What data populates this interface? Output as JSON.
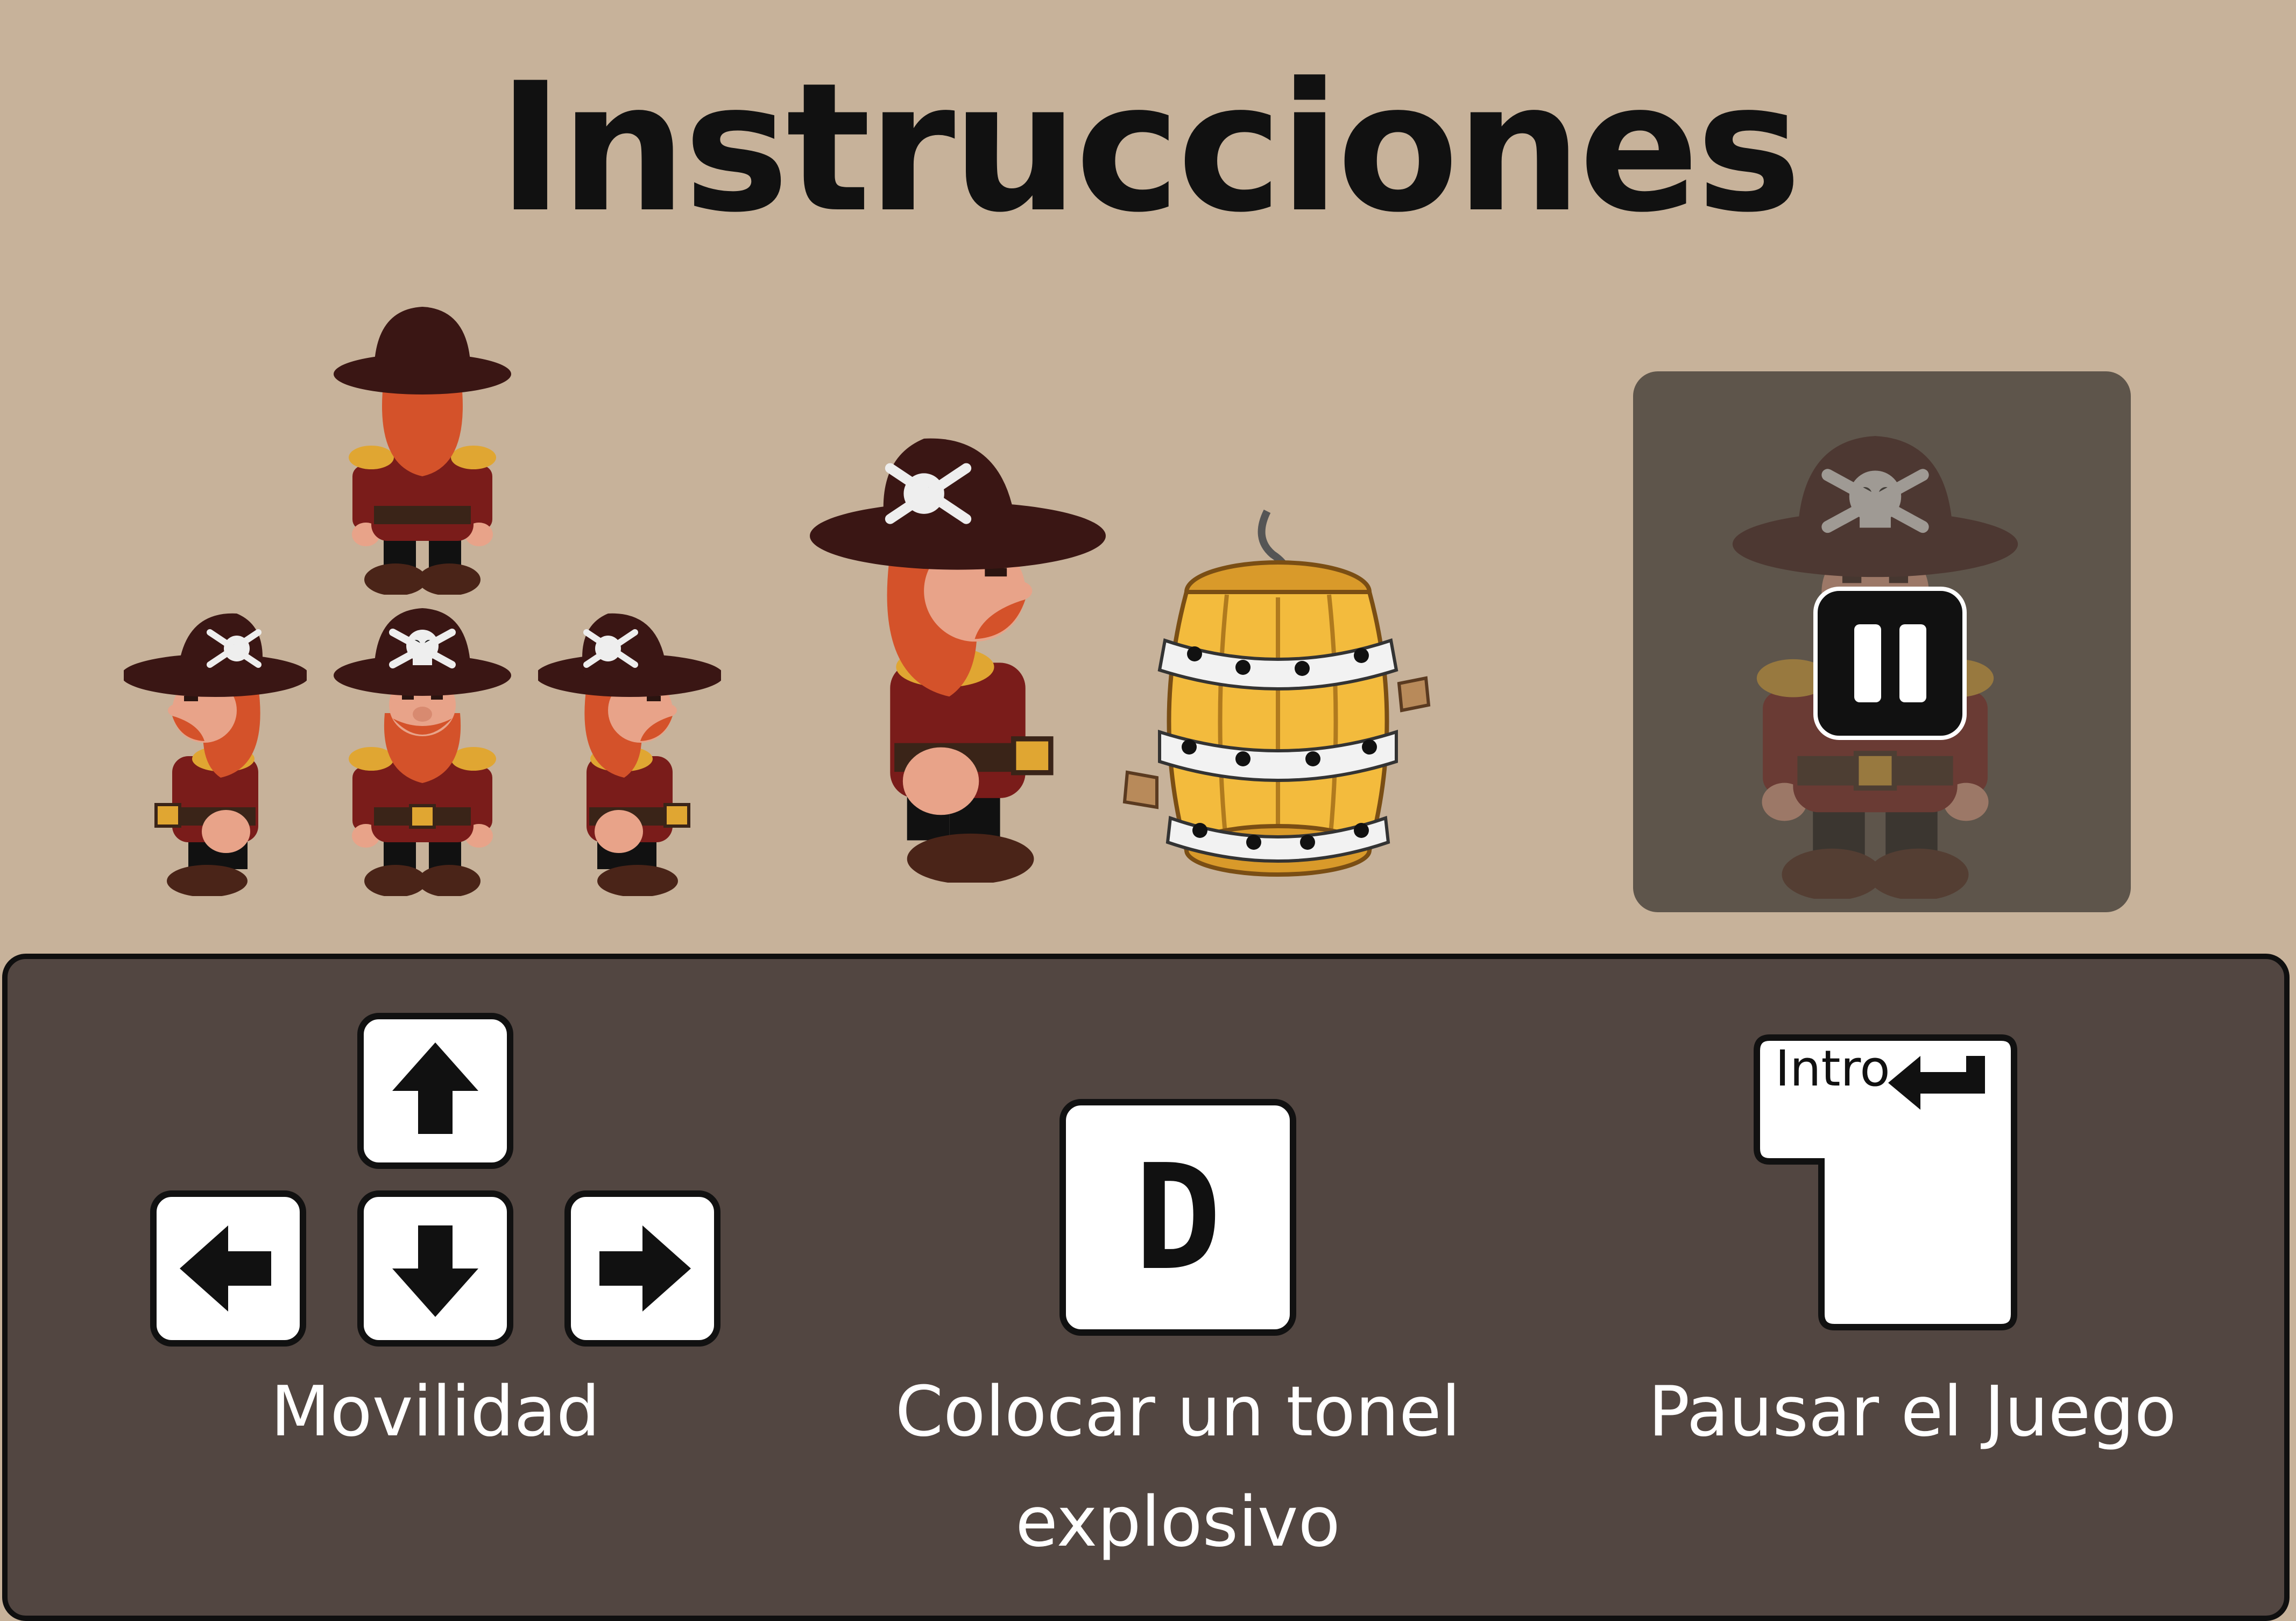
{
  "title": "Instrucciones",
  "controls": {
    "movement": {
      "keys": [
        "up-arrow",
        "left-arrow",
        "down-arrow",
        "right-arrow"
      ],
      "label": "Movilidad"
    },
    "bomb": {
      "key": "D",
      "label_line1": "Colocar un tonel",
      "label_line2": "explosivo"
    },
    "pause": {
      "key": "Intro",
      "label": "Pausar el Juego"
    }
  },
  "colors": {
    "background": "#c7b29a",
    "panel": "#524641",
    "pause_overlay": "#5e554b",
    "hat": "#3a1614",
    "beard": "#d4522a",
    "coat": "#7a1c1a",
    "gold": "#e0a632",
    "barrel": "#f3bb3d"
  }
}
